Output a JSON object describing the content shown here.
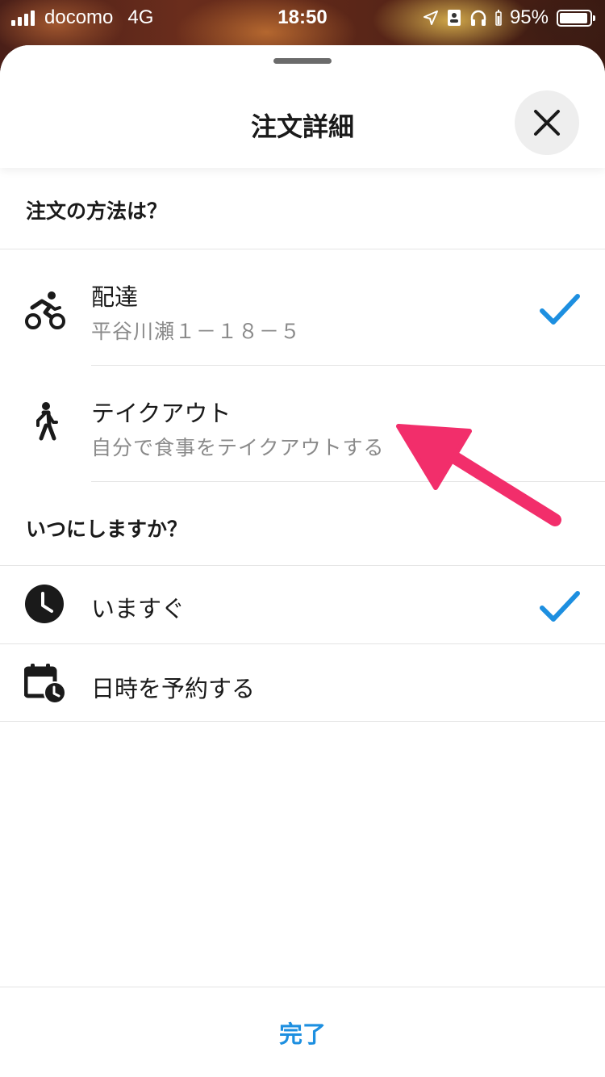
{
  "status_bar": {
    "carrier": "docomo",
    "network": "4G",
    "time": "18:50",
    "battery": "95%",
    "battery_level": 0.95
  },
  "sheet": {
    "title": "注文詳細",
    "close_icon": "close-icon"
  },
  "order_method": {
    "heading": "注文の方法は？",
    "options": [
      {
        "title": "配達",
        "subtitle": "平谷川瀬１－１８－５",
        "icon": "cyclist-icon",
        "selected": true
      },
      {
        "title": "テイクアウト",
        "subtitle": "自分で食事をテイクアウトする",
        "icon": "walking-person-icon",
        "selected": false
      }
    ]
  },
  "timing": {
    "heading": "いつにしますか？",
    "options": [
      {
        "title": "いますぐ",
        "icon": "clock-icon",
        "selected": true
      },
      {
        "title": "日時を予約する",
        "icon": "calendar-clock-icon",
        "selected": false
      }
    ]
  },
  "footer": {
    "done_label": "完了"
  },
  "colors": {
    "accent": "#1d8fe0",
    "annotation_arrow": "#f22e6b"
  }
}
